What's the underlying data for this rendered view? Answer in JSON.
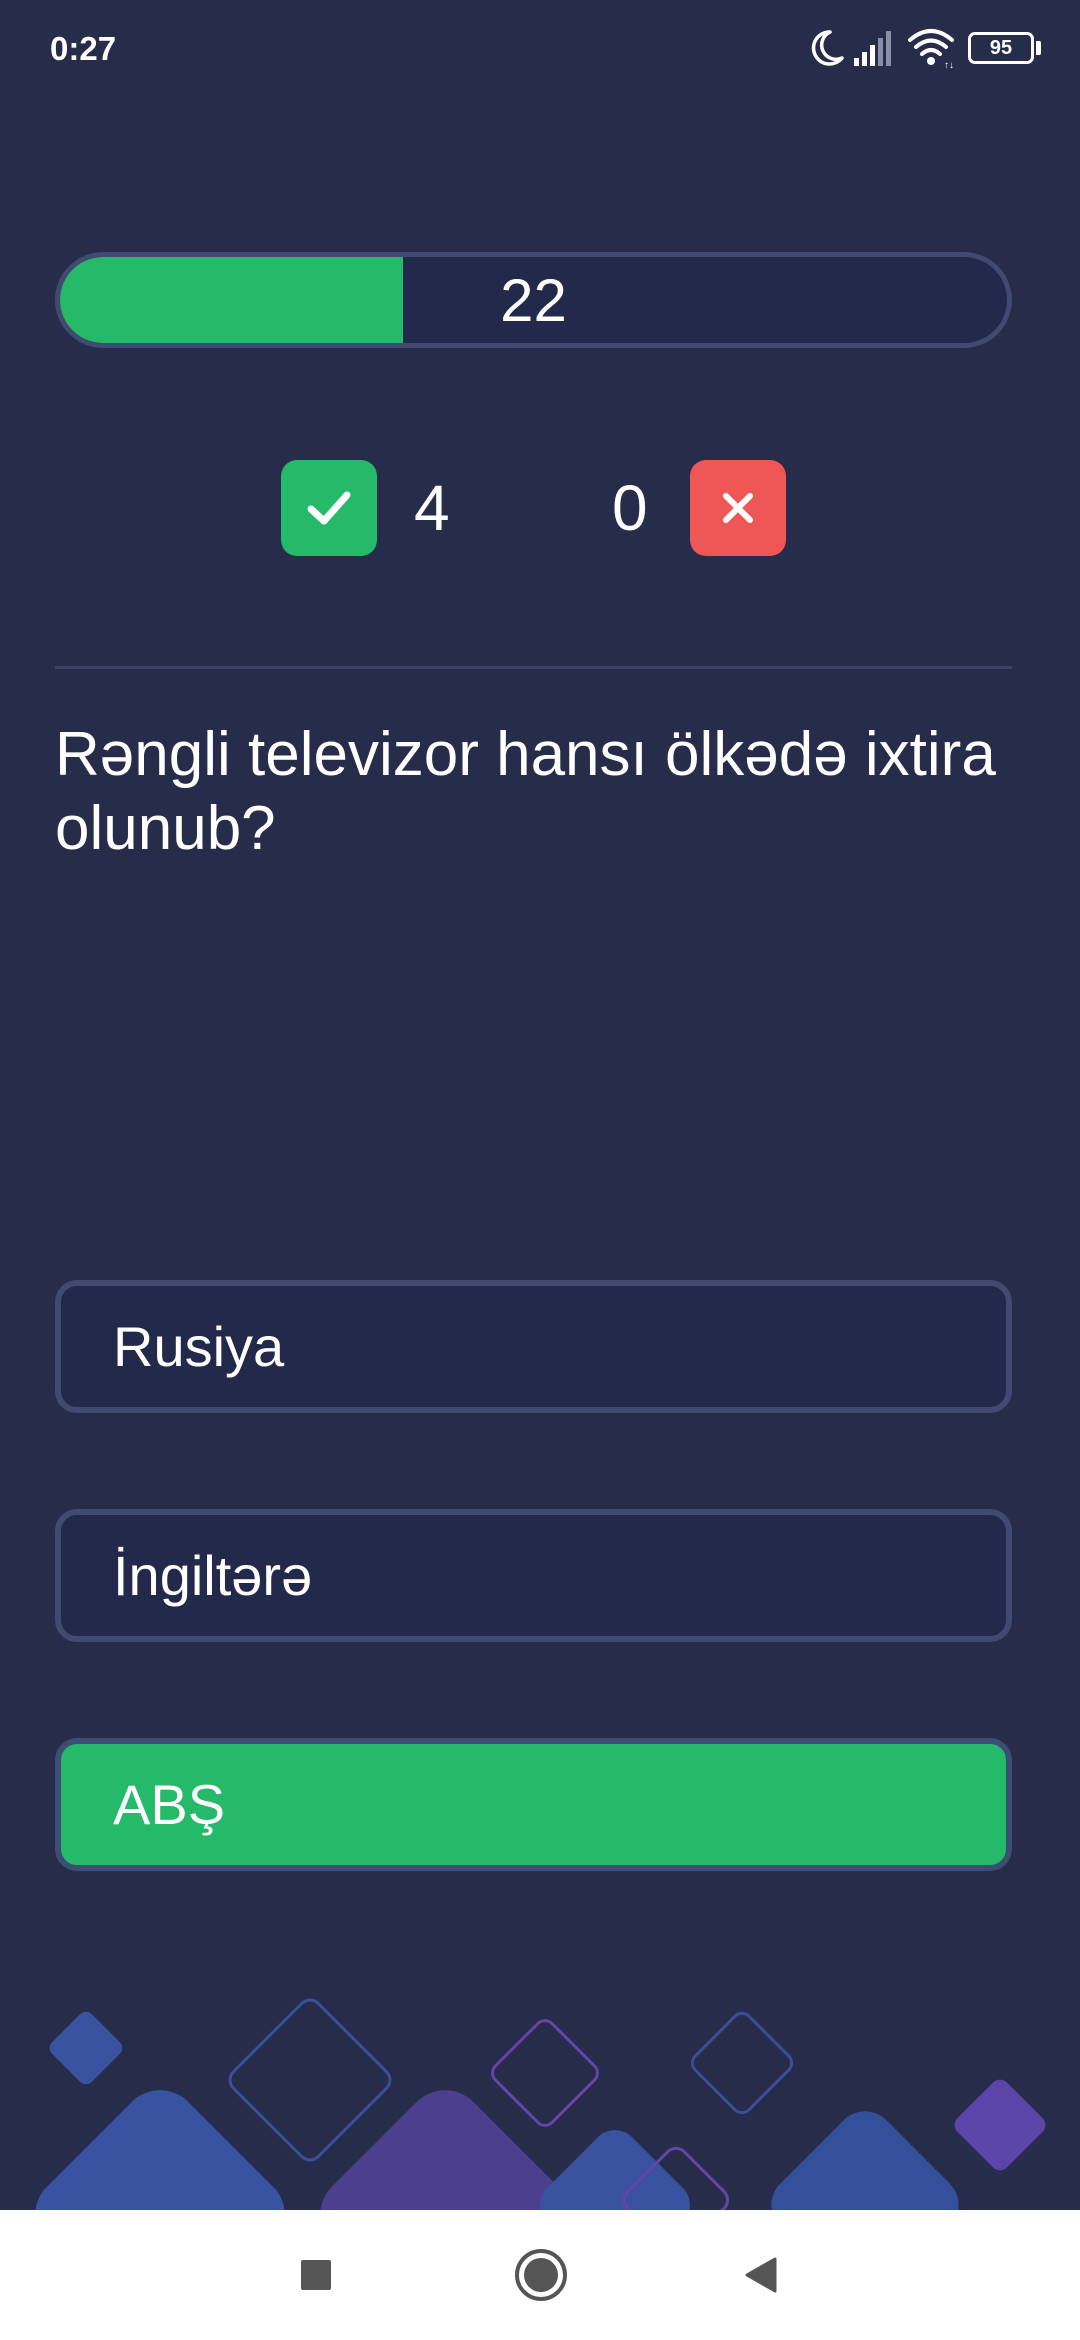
{
  "status_bar": {
    "time": "0:27",
    "battery": "95",
    "icons": [
      "moon-icon",
      "signal-icon",
      "wifi-icon",
      "battery-icon"
    ]
  },
  "progress": {
    "label": "22",
    "fraction": 0.362
  },
  "score": {
    "correct": "4",
    "wrong": "0"
  },
  "question": "Rəngli televizor hansı ölkədə ixtira olunub?",
  "answers": [
    {
      "label": "Rusiya",
      "state": "default"
    },
    {
      "label": "İngiltərə",
      "state": "default"
    },
    {
      "label": "ABŞ",
      "state": "correct"
    }
  ],
  "colors": {
    "background": "#262c4a",
    "accent_green": "#25b96a",
    "error_red": "#ef5656",
    "border": "#414a70"
  },
  "nav": {
    "icons": [
      "recents-square-icon",
      "home-circle-icon",
      "back-triangle-icon"
    ]
  }
}
